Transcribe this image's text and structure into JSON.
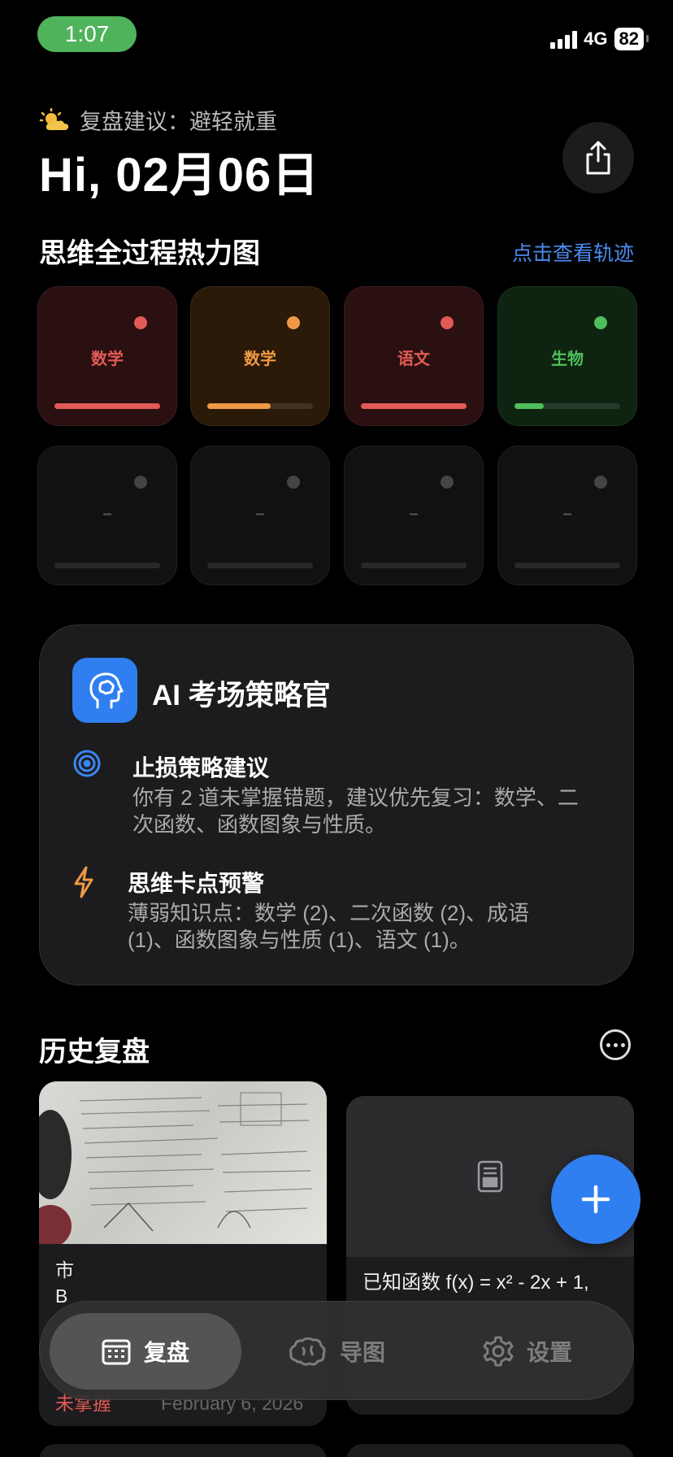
{
  "status": {
    "time": "1:07",
    "network": "4G",
    "battery": "82"
  },
  "header": {
    "advice": "复盘建议：避轻就重",
    "greeting": "Hi, 02月06日"
  },
  "heatmap": {
    "title": "思维全过程热力图",
    "link": "点击查看轨迹",
    "tiles": [
      {
        "label": "数学",
        "progress": 1.0,
        "color": "#e25a55",
        "bg": "#2a1010"
      },
      {
        "label": "数学",
        "progress": 0.6,
        "color": "#ee9a45",
        "bg": "#2b1a08"
      },
      {
        "label": "语文",
        "progress": 1.0,
        "color": "#e25a55",
        "bg": "#2a1010"
      },
      {
        "label": "生物",
        "progress": 0.28,
        "color": "#4fbf5c",
        "bg": "#0e2411"
      },
      {
        "label": "–",
        "progress": 0,
        "color": "#444446",
        "bg": "#111113"
      },
      {
        "label": "–",
        "progress": 0,
        "color": "#444446",
        "bg": "#111113"
      },
      {
        "label": "–",
        "progress": 0,
        "color": "#444446",
        "bg": "#111113"
      },
      {
        "label": "–",
        "progress": 0,
        "color": "#444446",
        "bg": "#111113"
      }
    ]
  },
  "ai_card": {
    "title": "AI 考场策略官",
    "items": [
      {
        "title": "止损策略建议",
        "text": "你有 2 道未掌握错题，建议优先复习：数学、二次函数、函数图象与性质。"
      },
      {
        "title": "思维卡点预警",
        "text": "薄弱知识点：数学 (2)、二次函数 (2)、成语 (1)、函数图象与性质 (1)、语文 (1)。"
      }
    ]
  },
  "history": {
    "title": "历史复盘",
    "cards": [
      {
        "line1": "市",
        "line2": "B",
        "status": "未掌握",
        "date": "February 6, 2026"
      },
      {
        "text": "已知函数 f(x) = x² - 2x + 1,"
      }
    ]
  },
  "tabs": [
    {
      "label": "复盘",
      "active": true
    },
    {
      "label": "导图",
      "active": false
    },
    {
      "label": "设置",
      "active": false
    }
  ]
}
